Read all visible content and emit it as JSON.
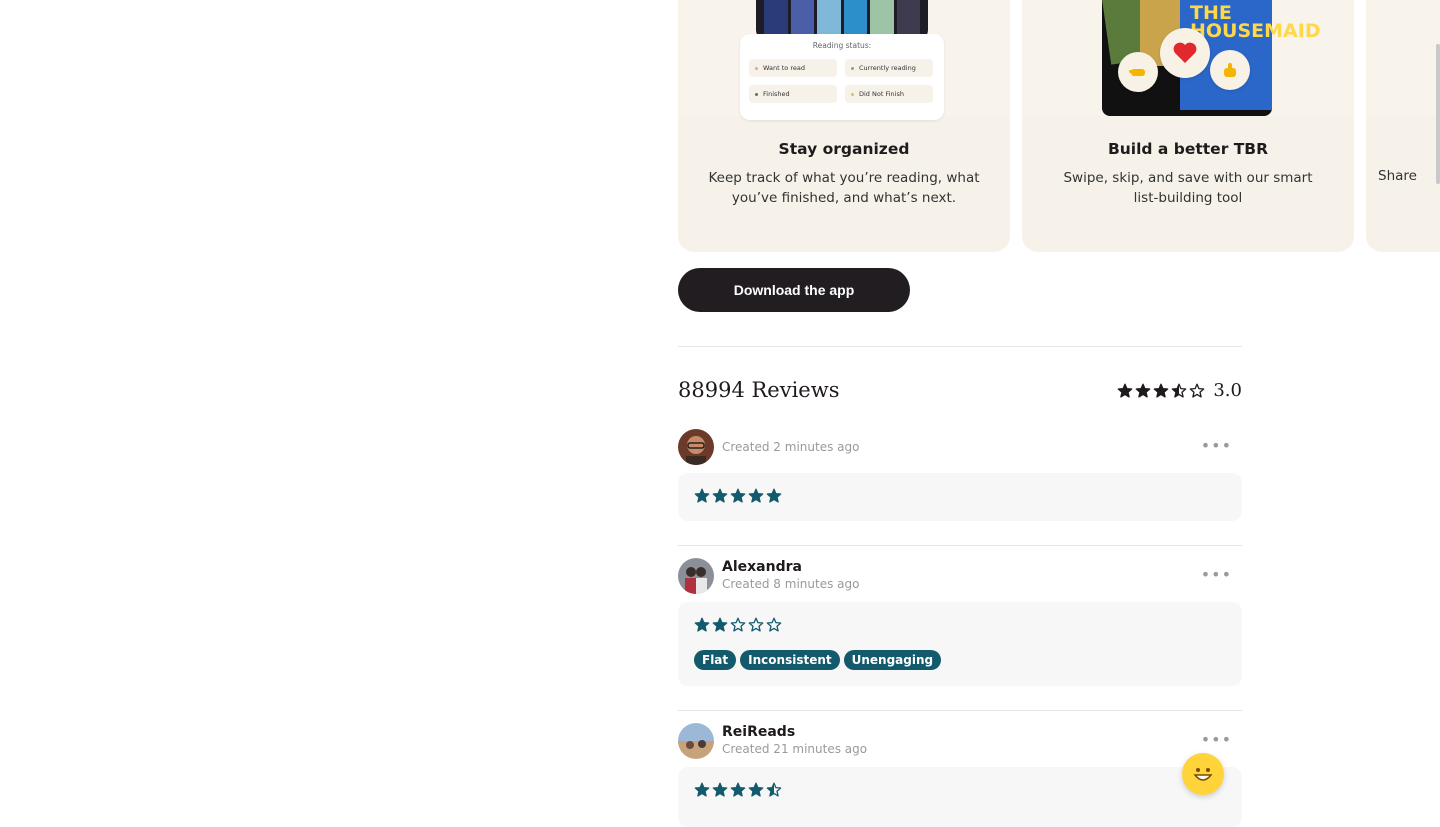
{
  "cards": [
    {
      "title": "Stay organized",
      "description": "Keep track of what you’re reading, what you’ve finished, and what’s next.",
      "reading_status": {
        "title": "Reading status:",
        "options": [
          "Want to read",
          "Currently reading",
          "Finished",
          "Did Not Finish"
        ]
      }
    },
    {
      "title": "Build a better TBR",
      "description": "Swipe, skip, and save with our smart list-building tool",
      "book_title": "THE HOUSEMAID"
    },
    {
      "description_partial": "Share"
    }
  ],
  "download_label": "Download the app",
  "reviews": {
    "count_label": "88994 Reviews",
    "overall_rating": "3.0",
    "overall_stars": 3.5,
    "items": [
      {
        "name": "",
        "created": "Created 2 minutes ago",
        "rating": 5,
        "tags": []
      },
      {
        "name": "Alexandra",
        "created": "Created 8 minutes ago",
        "rating": 2,
        "tags": [
          "Flat",
          "Inconsistent",
          "Unengaging"
        ]
      },
      {
        "name": "ReiReads",
        "created": "Created 21 minutes ago",
        "rating": 4.5,
        "tags": []
      }
    ]
  },
  "colors": {
    "accent": "#145a6d",
    "card_bg": "#f6f2ea",
    "button_bg": "#221d20"
  },
  "icons": {
    "more": "more-horizontal-icon",
    "chat": "grinning-face-icon"
  }
}
